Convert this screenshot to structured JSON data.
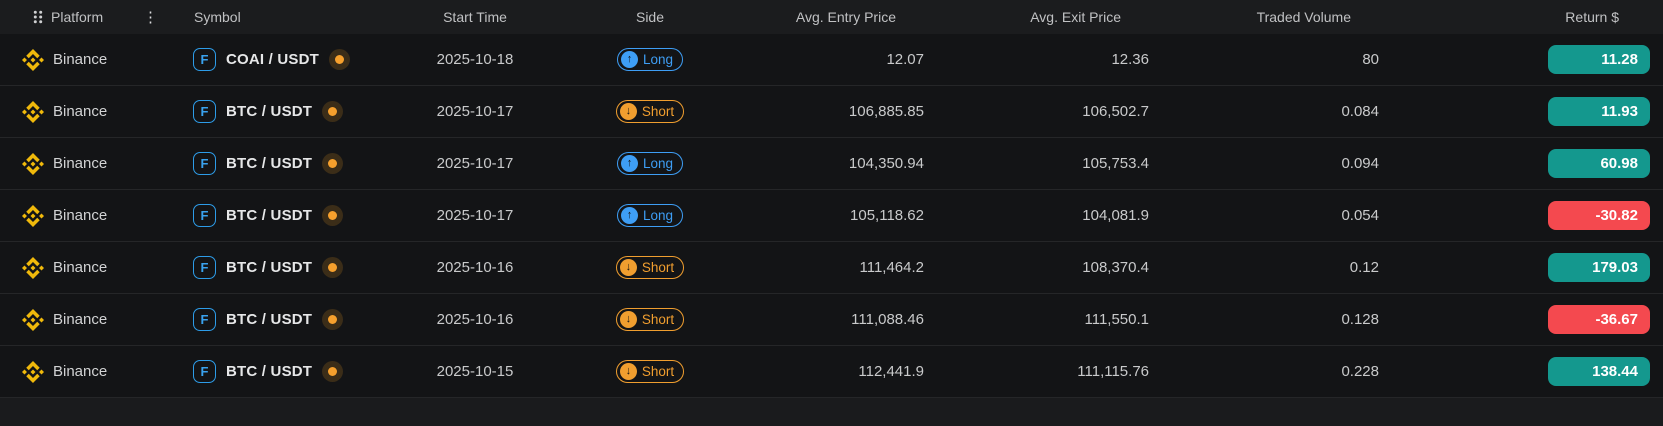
{
  "colors": {
    "header_bg": "#1b1c1e",
    "row_bg": "#131416",
    "divider": "#252628",
    "long_blue": "#3e9ef5",
    "short_orange": "#f09e2f",
    "positive_teal": "#14988e",
    "negative_red": "#f4494f",
    "binance_yellow": "#f0b90b",
    "hot_dot_orange": "#f6a02d"
  },
  "icons": {
    "drag_handle": "drag-handle-icon",
    "column_menu": "⋮",
    "long_arrow": "↑",
    "short_arrow": "↓"
  },
  "table": {
    "columns": [
      {
        "key": "platform",
        "label": "Platform"
      },
      {
        "key": "symbol",
        "label": "Symbol"
      },
      {
        "key": "start_time",
        "label": "Start Time"
      },
      {
        "key": "side",
        "label": "Side"
      },
      {
        "key": "entry",
        "label": "Avg. Entry Price"
      },
      {
        "key": "exit",
        "label": "Avg. Exit Price"
      },
      {
        "key": "volume",
        "label": "Traded Volume"
      },
      {
        "key": "return",
        "label": "Return $"
      }
    ],
    "rows": [
      {
        "platform": "Binance",
        "contract": "F",
        "symbol": "COAI / USDT",
        "start_time": "2025-10-18",
        "side": "Long",
        "entry": "12.07",
        "exit": "12.36",
        "volume": "80",
        "return": "11.28"
      },
      {
        "platform": "Binance",
        "contract": "F",
        "symbol": "BTC / USDT",
        "start_time": "2025-10-17",
        "side": "Short",
        "entry": "106,885.85",
        "exit": "106,502.7",
        "volume": "0.084",
        "return": "11.93"
      },
      {
        "platform": "Binance",
        "contract": "F",
        "symbol": "BTC / USDT",
        "start_time": "2025-10-17",
        "side": "Long",
        "entry": "104,350.94",
        "exit": "105,753.4",
        "volume": "0.094",
        "return": "60.98"
      },
      {
        "platform": "Binance",
        "contract": "F",
        "symbol": "BTC / USDT",
        "start_time": "2025-10-17",
        "side": "Long",
        "entry": "105,118.62",
        "exit": "104,081.9",
        "volume": "0.054",
        "return": "-30.82"
      },
      {
        "platform": "Binance",
        "contract": "F",
        "symbol": "BTC / USDT",
        "start_time": "2025-10-16",
        "side": "Short",
        "entry": "111,464.2",
        "exit": "108,370.4",
        "volume": "0.12",
        "return": "179.03"
      },
      {
        "platform": "Binance",
        "contract": "F",
        "symbol": "BTC / USDT",
        "start_time": "2025-10-16",
        "side": "Short",
        "entry": "111,088.46",
        "exit": "111,550.1",
        "volume": "0.128",
        "return": "-36.67"
      },
      {
        "platform": "Binance",
        "contract": "F",
        "symbol": "BTC / USDT",
        "start_time": "2025-10-15",
        "side": "Short",
        "entry": "112,441.9",
        "exit": "111,115.76",
        "volume": "0.228",
        "return": "138.44"
      }
    ]
  }
}
